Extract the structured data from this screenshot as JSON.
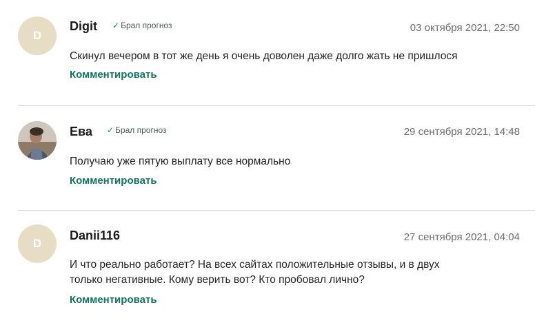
{
  "comments": [
    {
      "avatar_letter": "D",
      "author": "Digit",
      "badge": "Брал прогноз",
      "date": "03 октября 2021, 22:50",
      "text": "Скинул вечером в тот же день я очень доволен даже долго жать не пришлося",
      "reply_label": "Комментировать"
    },
    {
      "avatar_letter": "",
      "author": "Ева",
      "badge": "Брал прогноз",
      "date": "29 сентября 2021, 14:48",
      "text": "Получаю уже пятую выплату все нормально",
      "reply_label": "Комментировать"
    },
    {
      "avatar_letter": "D",
      "author": "Danii116",
      "badge": "",
      "date": "27 сентября 2021, 04:04",
      "text_lines": [
        "И что реально работает? На всех сайтах положительные отзывы, и в двух",
        "только негативные. Кому верить вот? Кто пробовал лично?"
      ],
      "reply_label": "Комментировать"
    }
  ],
  "icons": {
    "badge_check": "check-icon"
  },
  "colors": {
    "accent": "#0f7361",
    "avatar_bg": "#e7dcc4",
    "divider": "#d8d8d8"
  }
}
